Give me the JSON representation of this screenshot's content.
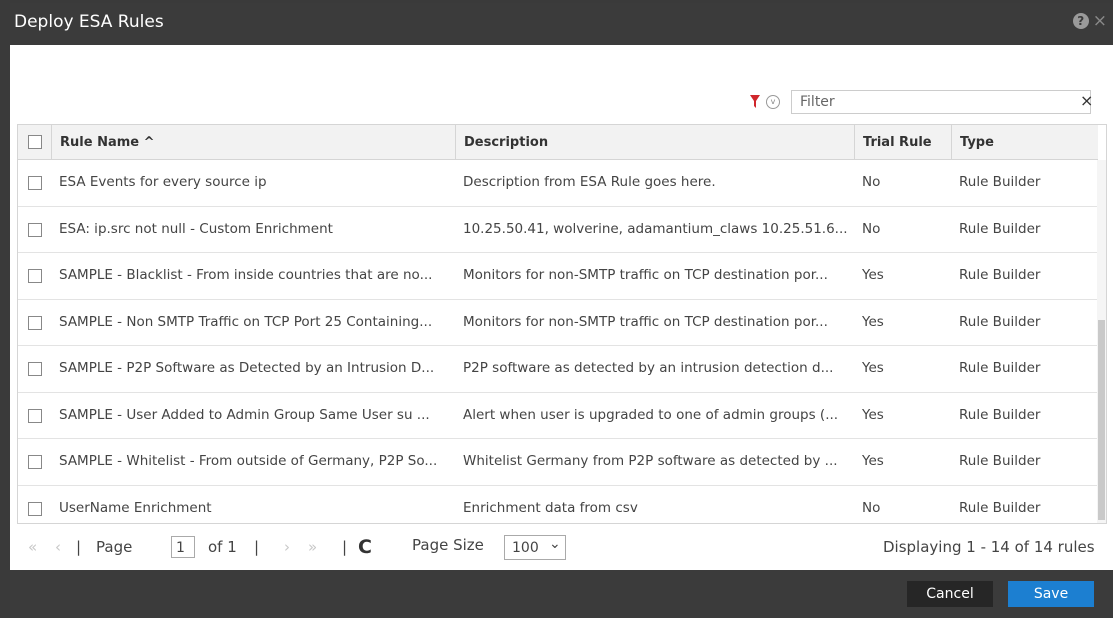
{
  "dialog": {
    "title": "Deploy ESA Rules",
    "help_glyph": "?",
    "close_glyph": "×"
  },
  "filter": {
    "placeholder": "Filter",
    "clear_glyph": "×"
  },
  "columns": {
    "rule_name": "Rule Name ^",
    "description": "Description",
    "trial_rule": "Trial Rule",
    "type": "Type"
  },
  "rows": [
    {
      "name": "ESA Events for every source ip",
      "description": "Description from ESA Rule goes here.",
      "trial": "No",
      "type": "Rule Builder"
    },
    {
      "name": "ESA: ip.src not null - Custom Enrichment",
      "description": "10.25.50.41, wolverine, adamantium_claws 10.25.51.6...",
      "trial": "No",
      "type": "Rule Builder"
    },
    {
      "name": "SAMPLE - Blacklist - From inside countries that are no...",
      "description": "Monitors for non-SMTP traffic on TCP destination por...",
      "trial": "Yes",
      "type": "Rule Builder"
    },
    {
      "name": "SAMPLE - Non SMTP Traffic on TCP Port 25 Containing...",
      "description": "Monitors for non-SMTP traffic on TCP destination por...",
      "trial": "Yes",
      "type": "Rule Builder"
    },
    {
      "name": "SAMPLE - P2P Software as Detected by an Intrusion D...",
      "description": "P2P software as detected by an intrusion detection d...",
      "trial": "Yes",
      "type": "Rule Builder"
    },
    {
      "name": "SAMPLE - User Added to Admin Group Same User su ...",
      "description": "Alert when user is upgraded to one of admin groups (...",
      "trial": "Yes",
      "type": "Rule Builder"
    },
    {
      "name": "SAMPLE - Whitelist - From outside of Germany, P2P So...",
      "description": "Whitelist Germany from P2P software as detected by ...",
      "trial": "Yes",
      "type": "Rule Builder"
    },
    {
      "name": "UserName Enrichment",
      "description": "Enrichment data from csv",
      "trial": "No",
      "type": "Rule Builder"
    }
  ],
  "pager": {
    "first_glyph": "«",
    "prev_glyph": "‹",
    "sep": "|",
    "page_label": "Page",
    "page_value": "1",
    "of_label": "of 1",
    "next_glyph": "›",
    "last_glyph": "»",
    "refresh_glyph": "C",
    "page_size_label": "Page Size",
    "page_size_value": "100",
    "dropdown_glyph": "⌄",
    "display_text": "Displaying 1 - 14 of 14 rules"
  },
  "buttons": {
    "cancel": "Cancel",
    "save": "Save"
  },
  "colors": {
    "accent": "#1c7fd1",
    "titlebar": "#3b3b3b",
    "funnel": "#d0262c"
  }
}
